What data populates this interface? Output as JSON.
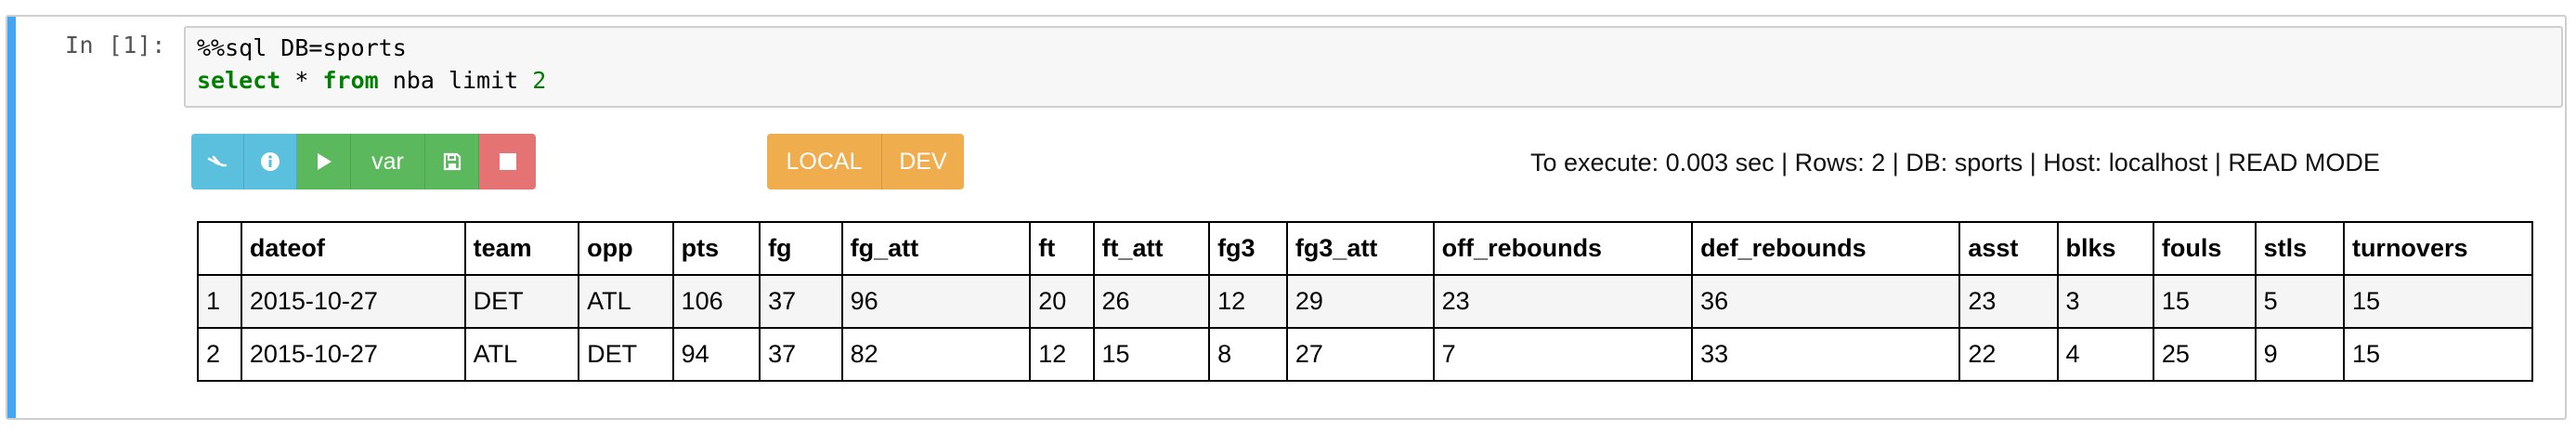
{
  "prompt": "In [1]:",
  "code": {
    "line1": "%%sql DB=sports",
    "line2_kw1": "select",
    "line2_mid1": " * ",
    "line2_kw2": "from",
    "line2_mid2": " nba limit ",
    "line2_num": "2"
  },
  "toolbar": {
    "buttons": [
      {
        "icon": "pin-icon",
        "color": "#5bc0de"
      },
      {
        "icon": "info-icon",
        "color": "#5bc0de"
      },
      {
        "icon": "play-icon",
        "color": "#5cb85c"
      },
      {
        "label": "var",
        "color": "#5cb85c"
      },
      {
        "icon": "save-icon",
        "color": "#5cb85c"
      },
      {
        "icon": "stop-icon",
        "color": "#e57373"
      }
    ],
    "env_local": "LOCAL",
    "env_dev": "DEV"
  },
  "status": "To execute: 0.003 sec | Rows: 2 | DB: sports | Host: localhost | READ MODE",
  "table": {
    "columns": [
      "",
      "dateof",
      "team",
      "opp",
      "pts",
      "fg",
      "fg_att",
      "ft",
      "ft_att",
      "fg3",
      "fg3_att",
      "off_rebounds",
      "def_rebounds",
      "asst",
      "blks",
      "fouls",
      "stls",
      "turnovers"
    ],
    "rows": [
      [
        "1",
        "2015-10-27",
        "DET",
        "ATL",
        "106",
        "37",
        "96",
        "20",
        "26",
        "12",
        "29",
        "23",
        "36",
        "23",
        "3",
        "15",
        "5",
        "15"
      ],
      [
        "2",
        "2015-10-27",
        "ATL",
        "DET",
        "94",
        "37",
        "82",
        "12",
        "15",
        "8",
        "27",
        "7",
        "33",
        "22",
        "4",
        "25",
        "9",
        "15"
      ]
    ]
  }
}
